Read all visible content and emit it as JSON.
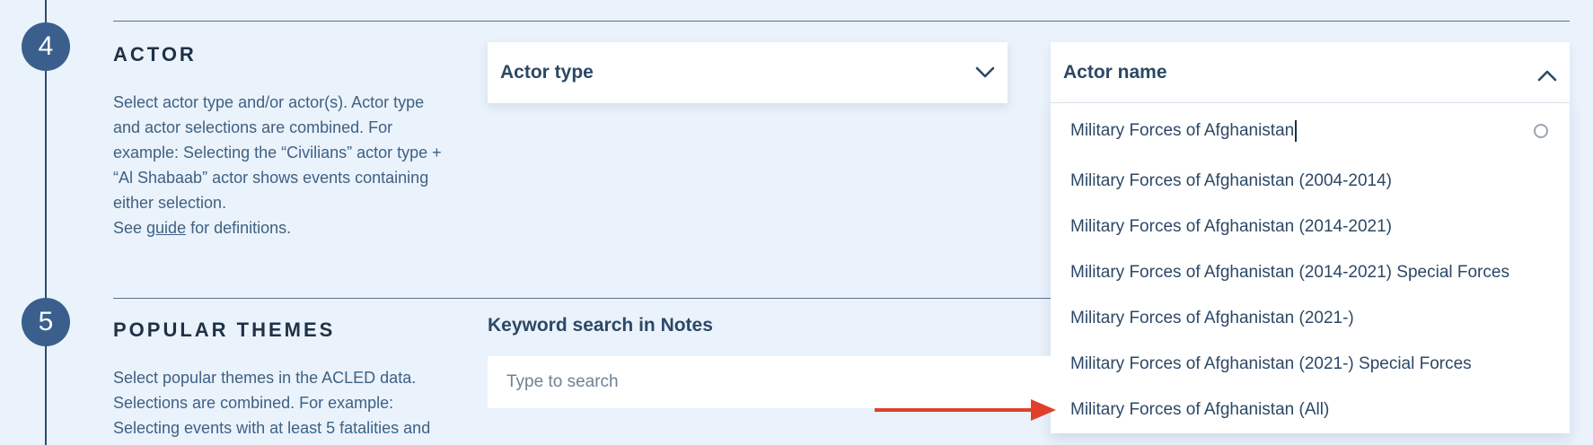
{
  "steps": {
    "actor": {
      "number": "4",
      "title": "ACTOR",
      "description_lines": [
        "Select actor type and/or actor(s). Actor type",
        "and actor selections are combined. For",
        "example: Selecting the “Civilians” actor type +",
        "“Al Shabaab” actor shows events containing",
        "either selection."
      ],
      "see_prefix": "See ",
      "guide_link": "guide",
      "see_suffix": " for definitions."
    },
    "themes": {
      "number": "5",
      "title": "POPULAR THEMES",
      "description_lines": [
        "Select popular themes in the ACLED data.",
        "Selections are combined. For example:",
        "Selecting events with at least 5 fatalities and"
      ]
    }
  },
  "actor_type": {
    "label": "Actor type",
    "icon": "chevron-down-icon"
  },
  "actor_name": {
    "label": "Actor name",
    "icon": "chevron-up-icon",
    "search_value": "Military Forces of Afghanistan",
    "options": [
      "Military Forces of Afghanistan (2004-2014)",
      "Military Forces of Afghanistan (2014-2021)",
      "Military Forces of Afghanistan (2014-2021) Special Forces",
      "Military Forces of Afghanistan (2021-)",
      "Military Forces of Afghanistan (2021-) Special Forces",
      "Military Forces of Afghanistan (All)"
    ]
  },
  "keyword_search": {
    "label": "Keyword search in Notes",
    "placeholder": "Type to search"
  },
  "colors": {
    "background": "#eaf2fb",
    "step_circle": "#3a5f8d",
    "annotation_arrow": "#e0402a"
  }
}
